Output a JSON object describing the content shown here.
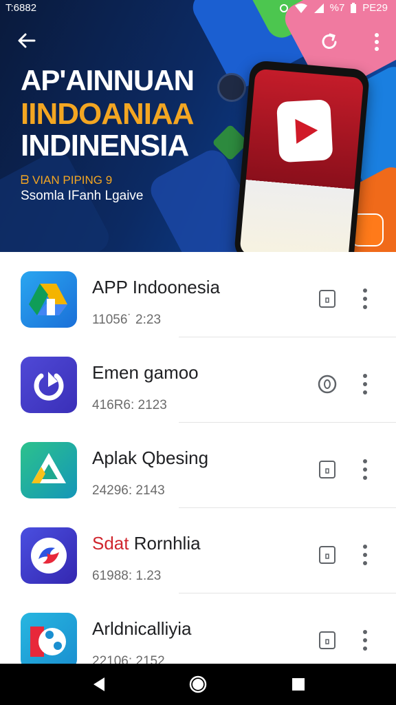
{
  "status_bar": {
    "time": "T:6882",
    "clock": "PE29",
    "battery_text": "%7",
    "icons": [
      "notification-icon",
      "wifi-icon",
      "signal-icon",
      "battery-icon"
    ]
  },
  "hero": {
    "title_line1": "AP'AINNUAN",
    "title_line2": "IINDOANIAA",
    "title_line3": "INDINENSIA",
    "subtitle_line1": "ᗷ VIAN PIPING 9",
    "subtitle_line2": "Ssomla IFanh Lgaive",
    "colors": {
      "accent": "#f3a622",
      "text": "#ffffff",
      "background": "#0c2a63",
      "play_red": "#d01a28"
    }
  },
  "apps": [
    {
      "name": "APP Indoonesia",
      "meta": "11056˙ 2:23",
      "icon": "drive-triangle-icon",
      "action_icon": "sd-card-icon"
    },
    {
      "name": "Emen gamoo",
      "meta": "416R6: 2123",
      "icon": "power-play-icon",
      "action_icon": "circle-o-icon"
    },
    {
      "name": "Aplak Qbesing",
      "meta": "24296: 2143",
      "icon": "drive-green-icon",
      "action_icon": "sd-card-icon"
    },
    {
      "name_red": "Sdat",
      "name": " Rornhlia",
      "meta": "61988: 1.23",
      "icon": "swirl-logo-icon",
      "action_icon": "sd-card-icon"
    },
    {
      "name": "Arldnicalliyia",
      "meta": "22106: 2152",
      "icon": "face-logo-icon",
      "action_icon": "sd-card-icon"
    }
  ],
  "colors": {
    "list_text": "#202124",
    "meta_text": "#6b6b6b",
    "nav_bar": "#000000",
    "red_text": "#d0262e"
  }
}
